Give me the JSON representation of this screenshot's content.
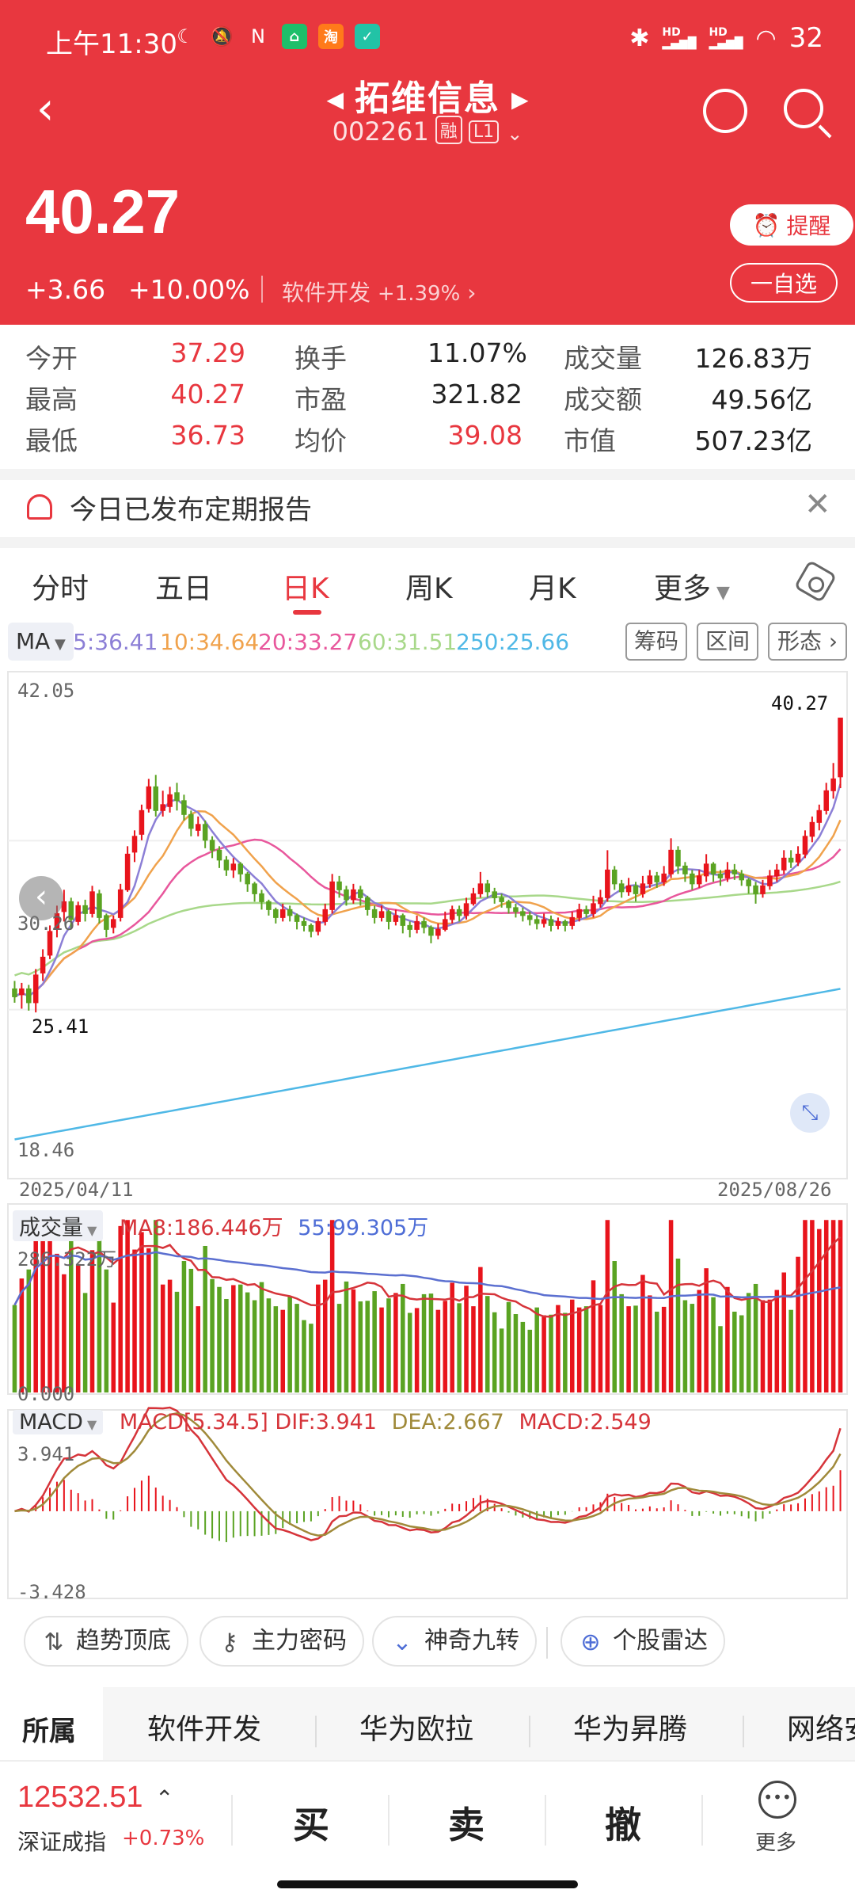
{
  "status_bar": {
    "time": "上午11:30",
    "battery": "32",
    "sig1": "HD",
    "sig2": "HD"
  },
  "nav": {
    "stock_name": "拓维信息",
    "code": "002261",
    "tag_margin": "融",
    "tag_level": "L1"
  },
  "quote": {
    "price": "40.27",
    "change": "+3.66",
    "change_pct": "+10.00%",
    "sector": "软件开发",
    "sector_pct": "+1.39%",
    "remind_label": "提醒",
    "watch_label": "一自选"
  },
  "stats": [
    {
      "label": "今开",
      "value": "37.29",
      "red": true
    },
    {
      "label": "换手",
      "value": "11.07%",
      "red": false
    },
    {
      "label": "成交量",
      "value": "126.83万",
      "red": false
    },
    {
      "label": "最高",
      "value": "40.27",
      "red": true
    },
    {
      "label": "市盈",
      "value": "321.82",
      "red": false
    },
    {
      "label": "成交额",
      "value": "49.56亿",
      "red": false
    },
    {
      "label": "最低",
      "value": "36.73",
      "red": true
    },
    {
      "label": "均价",
      "value": "39.08",
      "red": true
    },
    {
      "label": "市值",
      "value": "507.23亿",
      "red": false
    }
  ],
  "report_banner": "今日已发布定期报告",
  "tabs": [
    "分时",
    "五日",
    "日K",
    "周K",
    "月K",
    "更多"
  ],
  "active_tab": "日K",
  "ma_row": {
    "selector": "MA",
    "ma5": "5:36.41",
    "ma10": "10:34.64",
    "ma20": "20:33.27",
    "ma60": "60:31.51",
    "ma250": "250:25.66",
    "btn_chips": "筹码",
    "btn_range": "区间",
    "btn_pattern": "形态"
  },
  "colors": {
    "brand_red": "#e8373f",
    "up": "#e8141c",
    "down": "#5aa322",
    "ma5": "#8c7fd6",
    "ma10": "#f0a24c",
    "ma20": "#e8579c",
    "ma60": "#a8d88a",
    "ma250": "#4fb8e6"
  },
  "kline_axis": {
    "top": "42.05",
    "mid": "30.26",
    "bottom": "18.46",
    "low_label": "25.41",
    "high_label": "40.27",
    "date_start": "2025/04/11",
    "date_end": "2025/08/26"
  },
  "volume": {
    "title": "成交量",
    "ma8": "MA8:186.446万",
    "ma55": "55:99.305万",
    "top": "286.322万",
    "bottom": "0.000"
  },
  "macd": {
    "title": "MACD",
    "params": "MACD[5.34.5]",
    "dif": "DIF:3.941",
    "dea": "DEA:2.667",
    "macd": "MACD:2.549",
    "top": "3.941",
    "bottom": "-3.428"
  },
  "tools": [
    "趋势顶底",
    "主力密码",
    "神奇九转",
    "个股雷达"
  ],
  "sector_tabs": {
    "first": "所属",
    "items": [
      "软件开发",
      "华为欧拉",
      "华为昇腾",
      "网络安"
    ]
  },
  "bottom_bar": {
    "index_value": "12532.51",
    "index_name": "深证成指",
    "index_chg": "+0.73%",
    "buy": "买",
    "sell": "卖",
    "cancel": "撤",
    "more": "更多"
  },
  "chart_data": {
    "type": "candlestick",
    "x_range": [
      "2025/04/11",
      "2025/08/26"
    ],
    "ylim": [
      18.46,
      42.05
    ],
    "candles": [
      [
        26.6,
        26.2,
        27.0,
        25.9
      ],
      [
        26.3,
        26.6,
        26.9,
        25.6
      ],
      [
        26.6,
        25.9,
        26.8,
        25.5
      ],
      [
        25.9,
        27.3,
        27.6,
        25.41
      ],
      [
        27.4,
        28.2,
        28.6,
        27.0
      ],
      [
        28.3,
        29.5,
        29.8,
        28.1
      ],
      [
        29.6,
        30.4,
        30.8,
        29.2
      ],
      [
        30.5,
        31.0,
        31.6,
        30.0
      ],
      [
        31.0,
        30.1,
        31.2,
        29.6
      ],
      [
        30.0,
        30.8,
        31.0,
        29.8
      ],
      [
        30.8,
        30.4,
        31.1,
        30.0
      ],
      [
        30.4,
        31.5,
        31.8,
        30.2
      ],
      [
        31.4,
        30.2,
        31.6,
        29.9
      ],
      [
        30.3,
        29.6,
        30.4,
        29.2
      ],
      [
        29.7,
        30.1,
        30.3,
        29.4
      ],
      [
        30.2,
        31.6,
        31.9,
        30.0
      ],
      [
        31.6,
        33.4,
        33.8,
        31.5
      ],
      [
        33.5,
        34.3,
        34.6,
        33.0
      ],
      [
        34.4,
        35.6,
        35.9,
        34.1
      ],
      [
        35.7,
        36.8,
        37.2,
        35.5
      ],
      [
        36.8,
        35.6,
        37.4,
        35.3
      ],
      [
        35.6,
        35.9,
        36.6,
        35.3
      ],
      [
        35.8,
        36.4,
        36.8,
        35.5
      ],
      [
        36.5,
        36.1,
        37.0,
        35.6
      ],
      [
        36.1,
        35.4,
        36.4,
        35.1
      ],
      [
        35.4,
        34.7,
        35.6,
        34.3
      ],
      [
        34.6,
        34.9,
        35.3,
        34.3
      ],
      [
        34.9,
        34.1,
        35.1,
        33.7
      ],
      [
        34.1,
        33.6,
        34.3,
        33.2
      ],
      [
        33.6,
        33.1,
        33.8,
        32.7
      ],
      [
        33.1,
        32.6,
        33.3,
        32.3
      ],
      [
        32.6,
        32.9,
        33.2,
        32.2
      ],
      [
        32.9,
        32.4,
        33.0,
        32.0
      ],
      [
        32.4,
        31.9,
        32.5,
        31.5
      ],
      [
        31.9,
        31.4,
        32.0,
        31.0
      ],
      [
        31.4,
        31.0,
        31.6,
        30.6
      ],
      [
        31.0,
        30.6,
        31.1,
        30.3
      ],
      [
        30.6,
        30.2,
        30.7,
        29.9
      ],
      [
        30.2,
        30.6,
        30.9,
        30.0
      ],
      [
        30.6,
        30.3,
        30.8,
        30.0
      ],
      [
        30.3,
        30.0,
        30.4,
        29.6
      ],
      [
        30.0,
        29.8,
        30.2,
        29.5
      ],
      [
        29.8,
        29.5,
        29.9,
        29.2
      ],
      [
        29.5,
        30.0,
        30.2,
        29.3
      ],
      [
        30.0,
        30.6,
        30.9,
        29.8
      ],
      [
        30.6,
        32.0,
        32.4,
        30.4
      ],
      [
        32.0,
        31.6,
        32.3,
        31.2
      ],
      [
        31.6,
        31.1,
        31.8,
        30.8
      ],
      [
        31.1,
        31.6,
        31.9,
        30.9
      ],
      [
        31.6,
        31.2,
        31.8,
        30.8
      ],
      [
        31.2,
        30.6,
        31.3,
        30.3
      ],
      [
        30.6,
        30.2,
        30.8,
        29.9
      ],
      [
        30.2,
        30.5,
        30.8,
        30.0
      ],
      [
        30.5,
        30.0,
        30.6,
        29.6
      ],
      [
        30.0,
        30.3,
        30.6,
        29.8
      ],
      [
        30.3,
        29.8,
        30.4,
        29.4
      ],
      [
        29.8,
        29.6,
        30.0,
        29.2
      ],
      [
        29.6,
        30.0,
        30.3,
        29.4
      ],
      [
        30.0,
        29.7,
        30.2,
        29.4
      ],
      [
        29.7,
        29.3,
        29.8,
        28.9
      ],
      [
        29.3,
        29.6,
        29.9,
        29.1
      ],
      [
        29.6,
        30.1,
        30.5,
        29.5
      ],
      [
        30.1,
        30.6,
        30.8,
        29.9
      ],
      [
        30.6,
        30.3,
        30.8,
        30.0
      ],
      [
        30.3,
        30.9,
        31.2,
        30.1
      ],
      [
        30.9,
        31.4,
        31.7,
        30.8
      ],
      [
        31.4,
        31.9,
        32.5,
        31.2
      ],
      [
        31.9,
        31.5,
        32.1,
        31.2
      ],
      [
        31.5,
        31.2,
        31.7,
        30.9
      ],
      [
        31.2,
        31.0,
        31.4,
        30.7
      ],
      [
        31.0,
        30.7,
        31.1,
        30.4
      ],
      [
        30.7,
        30.5,
        30.9,
        30.2
      ],
      [
        30.5,
        30.3,
        30.7,
        30.0
      ],
      [
        30.3,
        30.1,
        30.5,
        29.8
      ],
      [
        30.1,
        29.9,
        30.3,
        29.6
      ],
      [
        29.9,
        30.1,
        30.4,
        29.7
      ],
      [
        30.1,
        29.8,
        30.3,
        29.5
      ],
      [
        29.8,
        30.0,
        30.2,
        29.6
      ],
      [
        30.0,
        29.8,
        30.1,
        29.5
      ],
      [
        29.8,
        30.2,
        30.5,
        29.6
      ],
      [
        30.2,
        30.6,
        30.9,
        30.0
      ],
      [
        30.6,
        30.4,
        30.8,
        30.2
      ],
      [
        30.4,
        30.9,
        31.3,
        30.2
      ],
      [
        30.9,
        31.2,
        31.6,
        30.7
      ],
      [
        31.2,
        32.6,
        33.6,
        31.0
      ],
      [
        32.6,
        31.9,
        32.8,
        31.6
      ],
      [
        31.9,
        31.5,
        32.1,
        31.2
      ],
      [
        31.5,
        31.8,
        32.2,
        31.3
      ],
      [
        31.8,
        31.4,
        32.0,
        31.0
      ],
      [
        31.4,
        31.9,
        32.3,
        31.2
      ],
      [
        31.9,
        32.3,
        32.6,
        31.7
      ],
      [
        32.3,
        32.0,
        32.5,
        31.7
      ],
      [
        32.0,
        32.4,
        32.8,
        31.8
      ],
      [
        32.4,
        33.6,
        34.2,
        32.2
      ],
      [
        33.6,
        32.8,
        33.8,
        32.4
      ],
      [
        32.8,
        32.4,
        33.0,
        32.0
      ],
      [
        32.4,
        31.9,
        32.6,
        31.6
      ],
      [
        31.9,
        32.3,
        32.6,
        31.7
      ],
      [
        32.3,
        32.9,
        33.4,
        32.0
      ],
      [
        32.9,
        32.4,
        33.0,
        32.0
      ],
      [
        32.4,
        32.2,
        32.6,
        31.8
      ],
      [
        32.2,
        32.6,
        33.0,
        32.0
      ],
      [
        32.6,
        32.4,
        32.9,
        32.1
      ],
      [
        32.4,
        32.1,
        32.6,
        31.8
      ],
      [
        32.1,
        31.8,
        32.2,
        31.4
      ],
      [
        31.8,
        31.4,
        32.0,
        30.9
      ],
      [
        31.4,
        31.8,
        32.1,
        31.2
      ],
      [
        31.8,
        32.3,
        32.6,
        31.6
      ],
      [
        32.3,
        32.6,
        32.9,
        32.0
      ],
      [
        32.6,
        33.2,
        33.6,
        32.4
      ],
      [
        33.2,
        33.0,
        33.6,
        32.7
      ],
      [
        33.0,
        33.4,
        33.8,
        32.8
      ],
      [
        33.4,
        34.3,
        34.6,
        33.2
      ],
      [
        34.3,
        35.0,
        35.3,
        34.0
      ],
      [
        35.0,
        35.6,
        35.9,
        34.6
      ],
      [
        35.6,
        36.6,
        37.0,
        35.4
      ],
      [
        36.6,
        37.2,
        38.0,
        36.2
      ],
      [
        37.3,
        40.27,
        40.27,
        36.73
      ]
    ]
  }
}
